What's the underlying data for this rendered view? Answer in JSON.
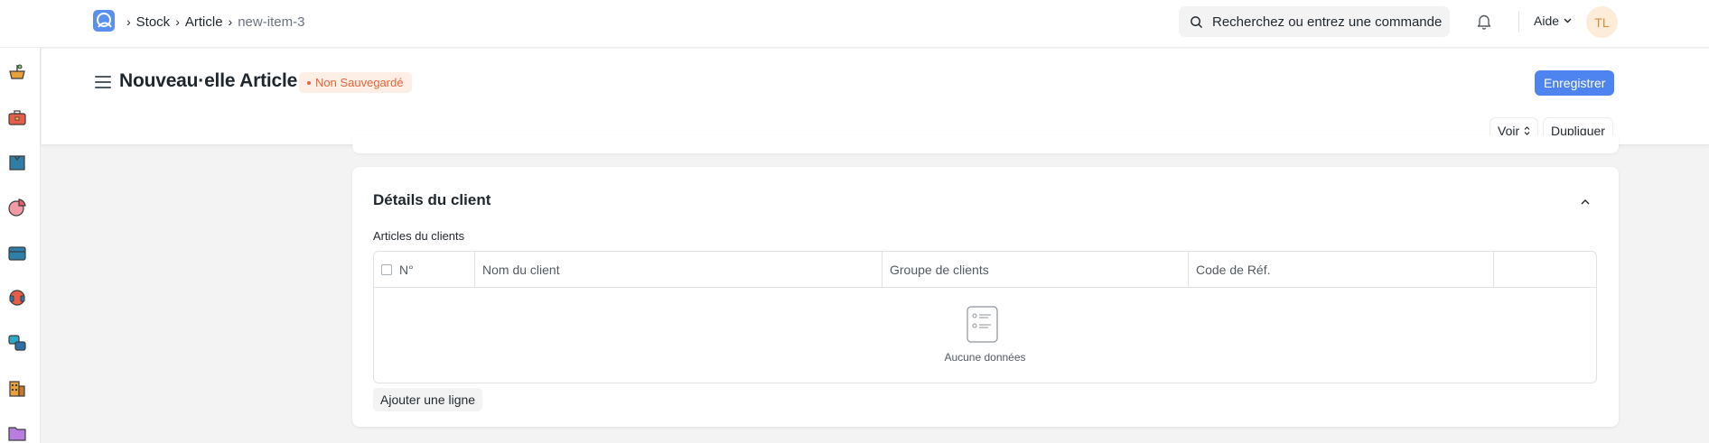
{
  "navbar": {
    "breadcrumbs": [
      "Stock",
      "Article",
      "new-item-3"
    ],
    "search_placeholder": "Recherchez ou entrez une commande",
    "help_label": "Aide",
    "avatar_initials": "TL"
  },
  "sidebar": {
    "icons": [
      "shopping-basket-icon",
      "toolbox-icon",
      "shirt-icon",
      "pie-chart-icon",
      "cash-register-icon",
      "headset-icon",
      "cubes-icon",
      "building-icon",
      "folder-icon"
    ]
  },
  "page_header": {
    "title": "Nouveau·elle Article",
    "status": "Non Sauvegardé",
    "save_label": "Enregistrer",
    "view_label": "Voir",
    "duplicate_label": "Dupliquer"
  },
  "section": {
    "title": "Détails du client",
    "table_label": "Articles du clients",
    "columns": [
      "N°",
      "Nom du client",
      "Groupe de clients",
      "Code de Réf."
    ],
    "empty_text": "Aucune données",
    "add_row_label": "Ajouter une ligne"
  },
  "colors": {
    "primary": "#4d84f0",
    "status_text": "#e8653a",
    "status_bg": "#fdeee6",
    "avatar_bg": "#fdecd8",
    "avatar_text": "#e08b3a"
  }
}
